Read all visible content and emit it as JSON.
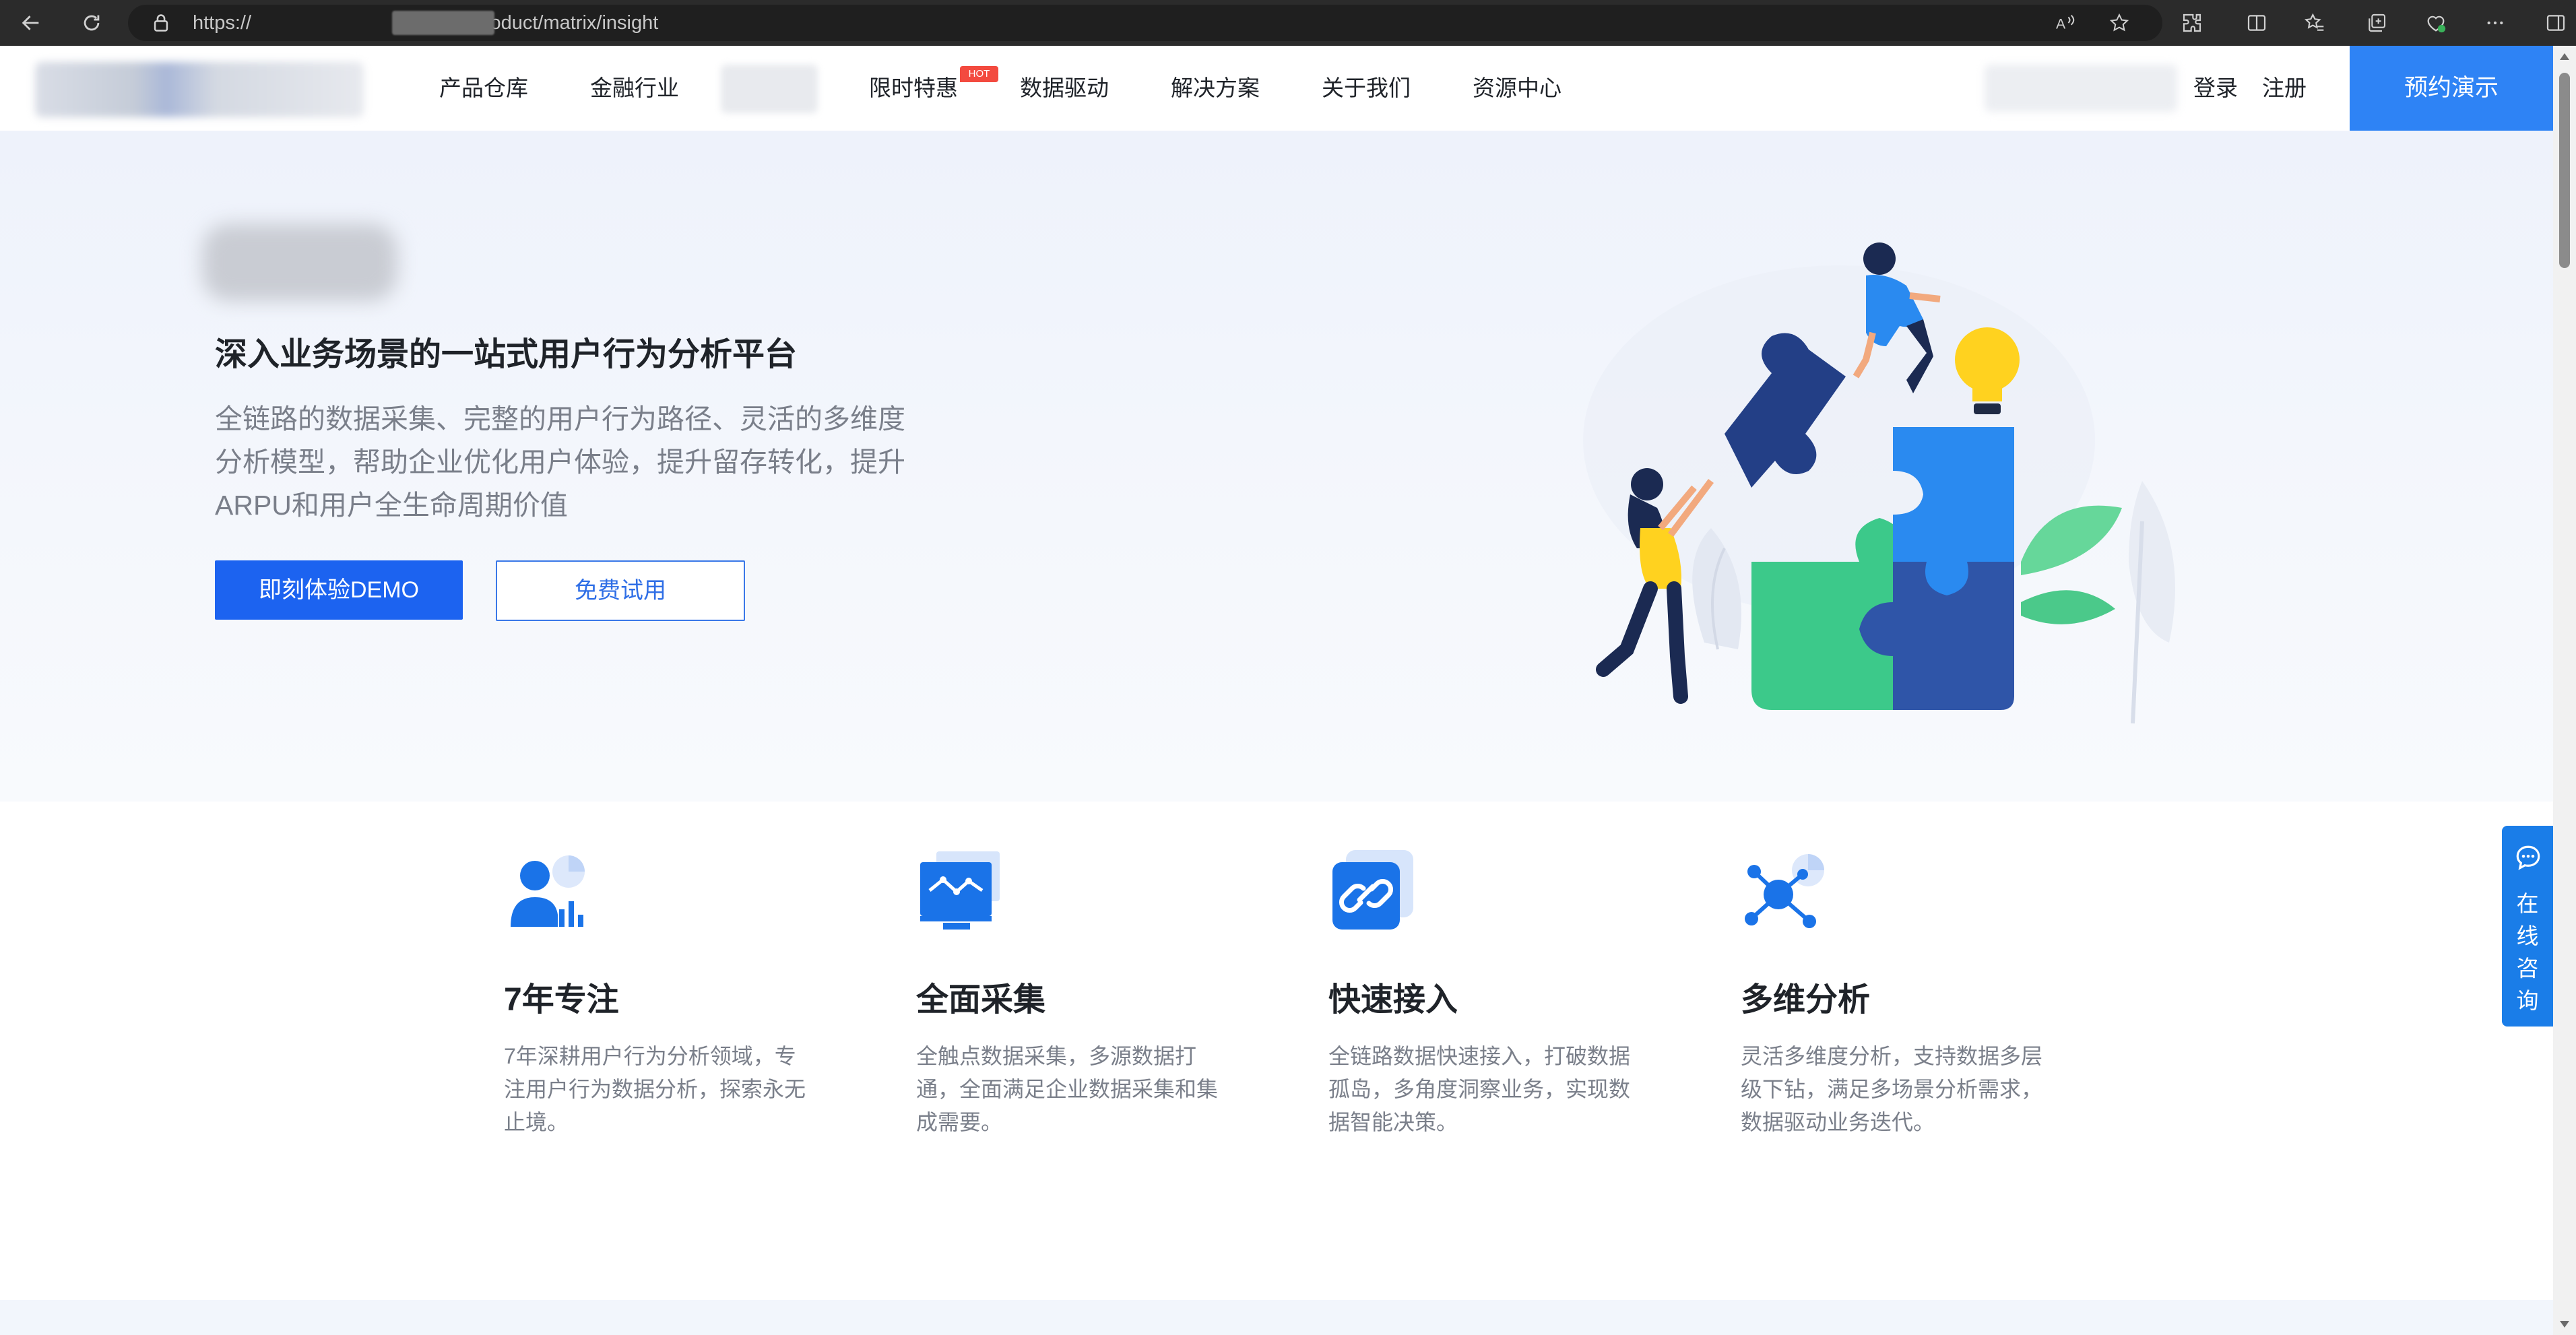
{
  "browser": {
    "url_prefix": "https://",
    "url_suffix": "/page/product/matrix/insight"
  },
  "nav": {
    "items": [
      "产品仓库",
      "金融行业",
      "限时特惠",
      "数据驱动",
      "解决方案",
      "关于我们",
      "资源中心"
    ],
    "hot_badge": "HOT",
    "login": "登录",
    "register": "注册",
    "demo": "预约演示"
  },
  "hero": {
    "title": "深入业务场景的一站式用户行为分析平台",
    "description": "全链路的数据采集、完整的用户行为路径、灵活的多维度分析模型，帮助企业优化用户体验，提升留存转化，提升ARPU和用户全生命周期价值",
    "primary_button": "即刻体验DEMO",
    "secondary_button": "免费试用"
  },
  "features": [
    {
      "icon": "user-chart-icon",
      "title": "7年专注",
      "desc": "7年深耕用户行为分析领域，专注用户行为数据分析，探索永无止境。"
    },
    {
      "icon": "monitor-chart-icon",
      "title": "全面采集",
      "desc": "全触点数据采集，多源数据打通，全面满足企业数据采集和集成需要。"
    },
    {
      "icon": "link-icon",
      "title": "快速接入",
      "desc": "全链路数据快速接入，打破数据孤岛，多角度洞察业务，实现数据智能决策。"
    },
    {
      "icon": "network-icon",
      "title": "多维分析",
      "desc": "灵活多维度分析，支持数据多层级下钻，满足多场景分析需求，数据驱动业务迭代。"
    }
  ],
  "chat": {
    "label": "在线咨询"
  },
  "colors": {
    "accent": "#1c63f0",
    "header_button": "#2e83f5",
    "hot": "#f34a3f",
    "chat": "#1a7de8"
  }
}
